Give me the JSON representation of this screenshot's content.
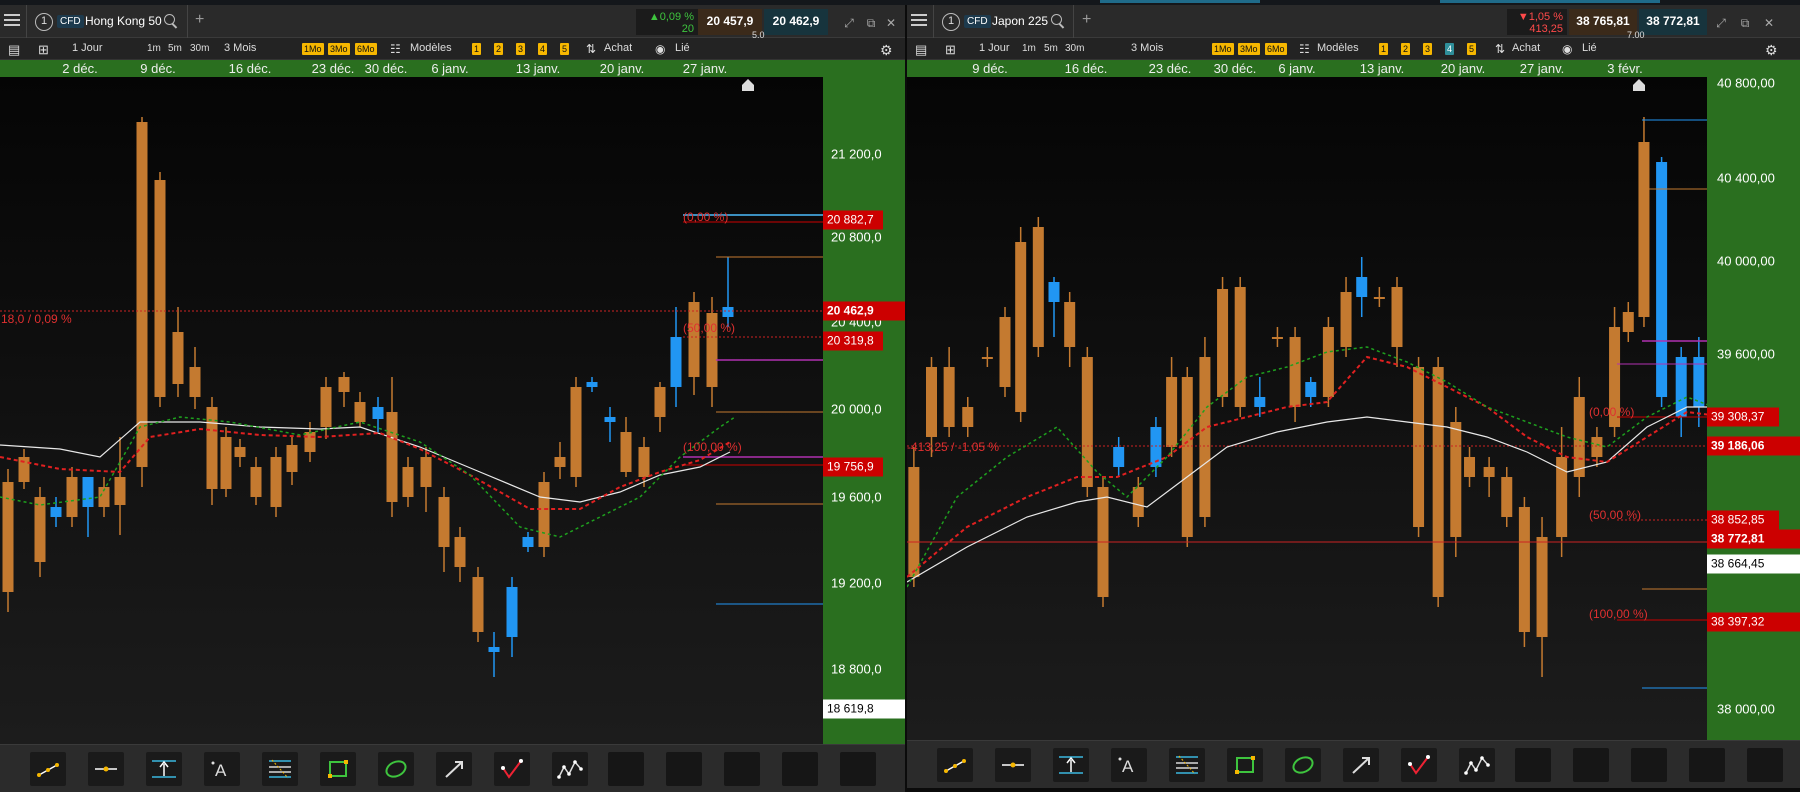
{
  "left": {
    "tab_number": "1",
    "cfd": "CFD",
    "instrument": "Hong Kong 50",
    "change_pct": "▲0,09 %",
    "change_pts": "20",
    "bid": "20 457,9",
    "ask": "20 462,9",
    "spread": "5,0",
    "toolbar": {
      "interval": "1 Jour",
      "m1": "1m",
      "m5": "5m",
      "m30": "30m",
      "range": "3 Mois",
      "mo1": "1Mo",
      "mo3": "3Mo",
      "mo6": "6Mo",
      "models": "Modèles",
      "n1": "1",
      "n2": "2",
      "n3": "3",
      "n4": "4",
      "n5": "5",
      "buy": "Achat",
      "linked": "Lié"
    },
    "dates": [
      "2 déc.",
      "9 déc.",
      "16 déc.",
      "23 déc.",
      "30 déc.",
      "6 janv.",
      "13 janv.",
      "20 janv.",
      "27 janv."
    ],
    "yticks": [
      "21 200,0",
      "20 800,0",
      "20 400,0",
      "20 000,0",
      "19 600,0",
      "19 200,0",
      "18 800,0"
    ],
    "badges": {
      "high": "20 882,7",
      "price": "20 462,9",
      "fib50": "20 319,8",
      "low": "19 756,9",
      "cursor": "18 619,8"
    },
    "labels": {
      "fib0": "(0,00 %)",
      "fib50": "(50,00 %)",
      "fib100": "(100,00 %)",
      "change": "18,0 / 0,09 %"
    }
  },
  "right": {
    "tab_number": "1",
    "cfd": "CFD",
    "instrument": "Japon 225",
    "change_pct": "▼1,05 %",
    "change_pts": "413,25",
    "bid": "38 765,81",
    "ask": "38 772,81",
    "spread": "7,00",
    "toolbar": {
      "interval": "1 Jour",
      "m1": "1m",
      "m5": "5m",
      "m30": "30m",
      "range": "3 Mois",
      "mo1": "1Mo",
      "mo3": "3Mo",
      "mo6": "6Mo",
      "models": "Modèles",
      "n1": "1",
      "n2": "2",
      "n3": "3",
      "n4": "4",
      "n5": "5",
      "buy": "Achat",
      "linked": "Lié"
    },
    "dates": [
      "9 déc.",
      "16 déc.",
      "23 déc.",
      "30 déc.",
      "6 janv.",
      "13 janv.",
      "20 janv.",
      "27 janv.",
      "3 févr."
    ],
    "yticks": [
      "40 800,00",
      "40 400,00",
      "40 000,00",
      "39 600,00",
      "38 000,00"
    ],
    "badges": {
      "b1": "39 308,37",
      "b2": "39 186,06",
      "b3": "38 852,85",
      "price": "38 772,81",
      "cursor": "38 664,45",
      "low": "38 397,32"
    },
    "labels": {
      "fib0": "(0,00 %)",
      "fib50": "(50,00 %)",
      "fib100": "(100,00 %)",
      "change": "-413,25 / -1,05 %"
    }
  },
  "colors": {
    "up": "#2196f3",
    "down": "#c47a30",
    "axis_bg": "#2a6f1f",
    "red_badge": "#cc0000"
  },
  "tools": [
    "line-tool-icon",
    "horizontal-line-icon",
    "channel-tool-icon",
    "text-tool-icon",
    "fibonacci-tool-icon",
    "rectangle-tool-icon",
    "ellipse-tool-icon",
    "arrow-tool-icon",
    "pattern-tool-icon",
    "wave-tool-icon"
  ]
}
